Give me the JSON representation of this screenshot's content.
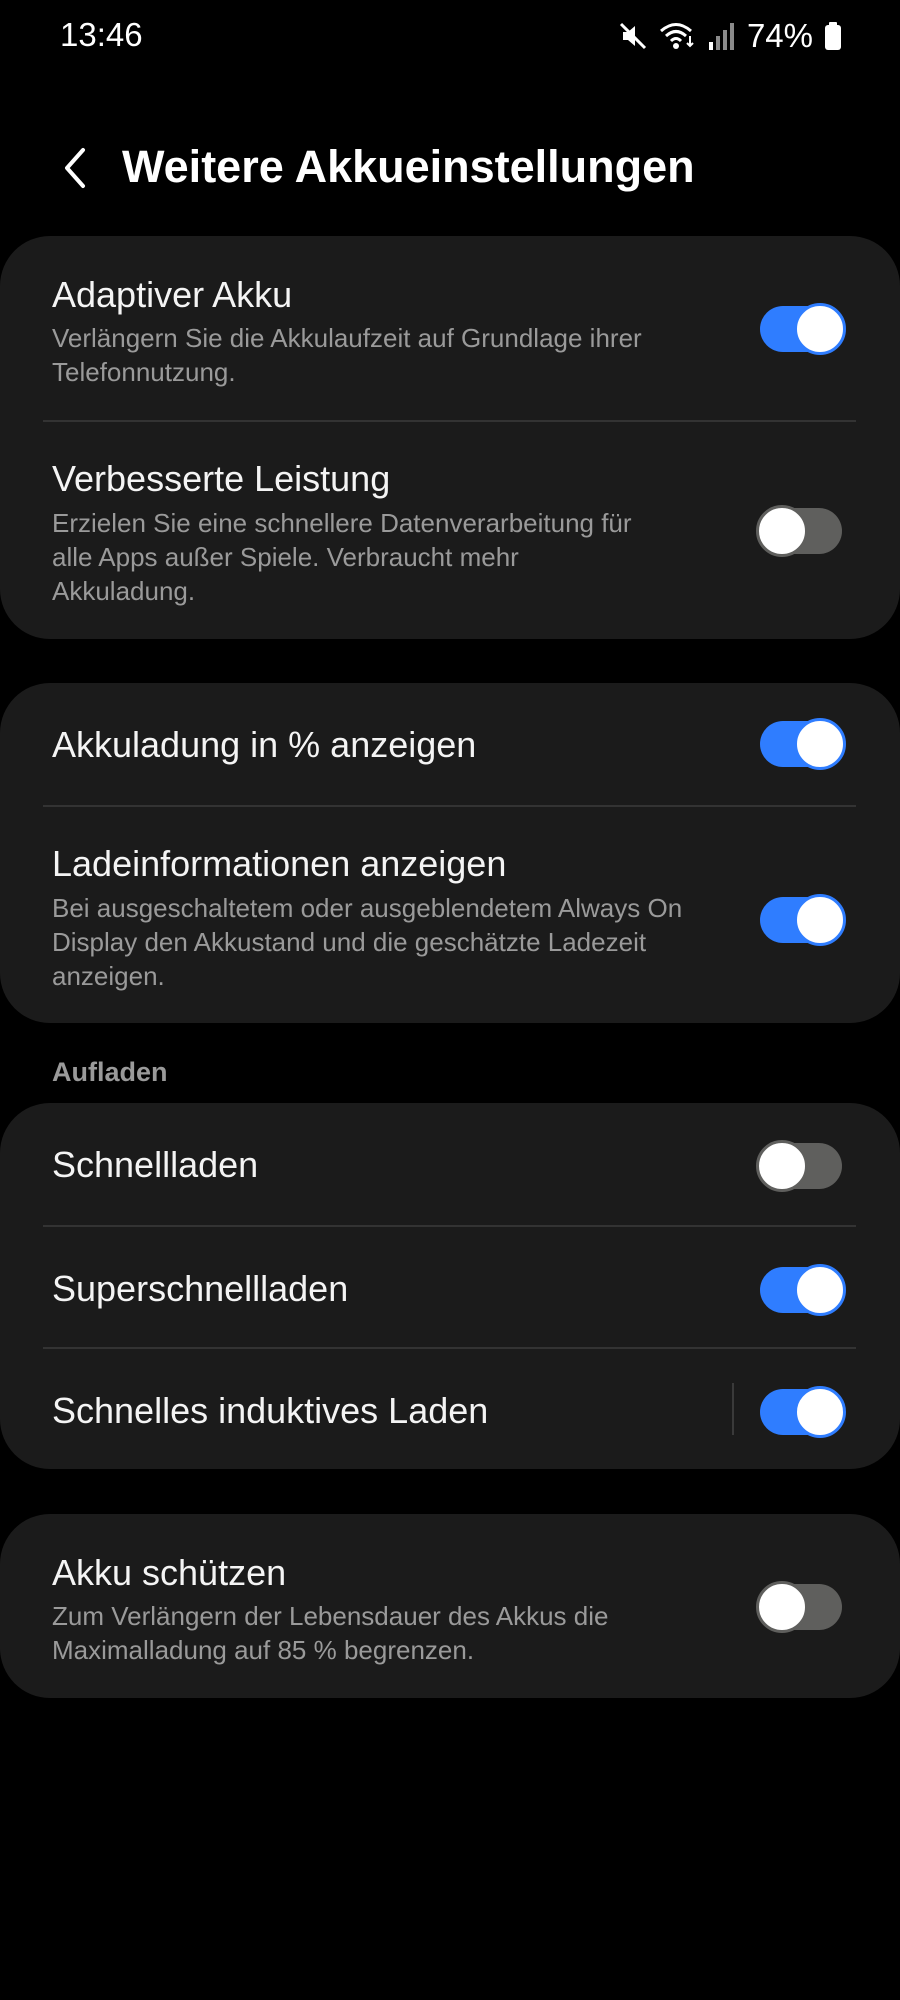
{
  "status_bar": {
    "time": "13:46",
    "battery_percent": "74%",
    "icons": [
      "mute-icon",
      "wifi-icon",
      "signal-icon",
      "battery-icon"
    ]
  },
  "header": {
    "back_icon": "chevron-left-icon",
    "title": "Weitere Akkueinstellungen"
  },
  "group1": {
    "adaptive_battery": {
      "title": "Adaptiver Akku",
      "subtitle": "Verlängern Sie die Akkulaufzeit auf Grundlage ihrer Telefonnutzung.",
      "enabled": true
    },
    "enhanced_performance": {
      "title": "Verbesserte Leistung",
      "subtitle": "Erzielen Sie eine schnellere Datenverarbeitung für alle Apps außer Spiele. Verbraucht mehr Akkuladung.",
      "enabled": false
    }
  },
  "group2": {
    "show_percentage": {
      "title": "Akkuladung in % anzeigen",
      "enabled": true
    },
    "charging_info": {
      "title": "Ladeinformationen anzeigen",
      "subtitle": "Bei ausgeschaltetem oder ausgeblendetem Always On Display den Akkustand und die geschätzte Ladezeit anzeigen.",
      "enabled": true
    }
  },
  "charging": {
    "section_label": "Aufladen",
    "fast_charging": {
      "title": "Schnellladen",
      "enabled": false
    },
    "super_fast_charging": {
      "title": "Superschnellladen",
      "enabled": true
    },
    "fast_wireless_charging": {
      "title": "Schnelles induktives Laden",
      "enabled": true
    }
  },
  "protect": {
    "protect_battery": {
      "title": "Akku schützen",
      "subtitle": "Zum Verlängern der Lebensdauer des Akkus die Maximalladung auf 85 % begrenzen.",
      "enabled": false
    }
  },
  "colors": {
    "background": "#000000",
    "card": "#1b1b1b",
    "toggle_on": "#2f7dff",
    "toggle_off": "#5f5f5d",
    "subtitle": "#9a9a9a"
  }
}
